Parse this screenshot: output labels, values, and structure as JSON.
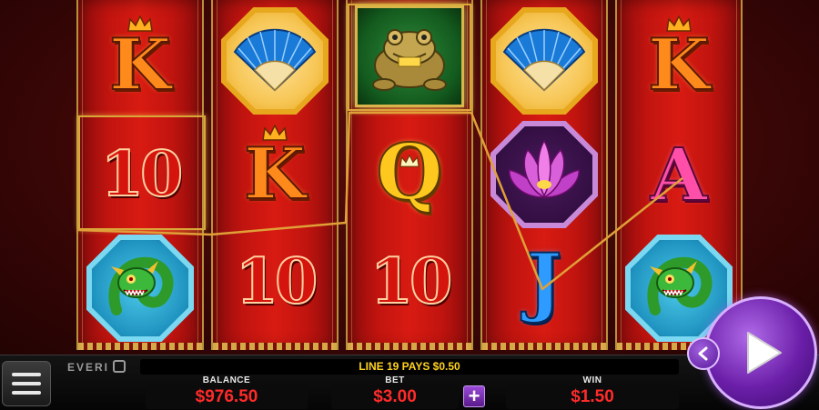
{
  "message": "LINE 19 PAYS $0.50",
  "brand": "EVERI",
  "meters": {
    "balance_label": "BALANCE",
    "balance_value": "$976.50",
    "bet_label": "BET",
    "bet_value": "$3.00",
    "win_label": "WIN",
    "win_value": "$1.50"
  },
  "reels": [
    {
      "symbols": [
        "K",
        "10",
        "dragon"
      ]
    },
    {
      "symbols": [
        "fan",
        "K",
        "10"
      ]
    },
    {
      "symbols": [
        "frog",
        "Q",
        "10"
      ]
    },
    {
      "symbols": [
        "fan",
        "lotus",
        "J"
      ]
    },
    {
      "symbols": [
        "K",
        "A",
        "dragon"
      ]
    }
  ],
  "labels": {
    "k": "K",
    "q": "Q",
    "a": "A",
    "j": "J",
    "ten": "10"
  },
  "icons": {
    "menu": "hamburger-menu-icon",
    "spin": "play-triangle-icon",
    "back": "chevron-left-icon",
    "plus": "+"
  },
  "colors": {
    "message_text": "#ffd21e",
    "meter_value": "#ff2a2a",
    "accent_purple": "#6a1ea8",
    "payline": "#e0a038"
  }
}
